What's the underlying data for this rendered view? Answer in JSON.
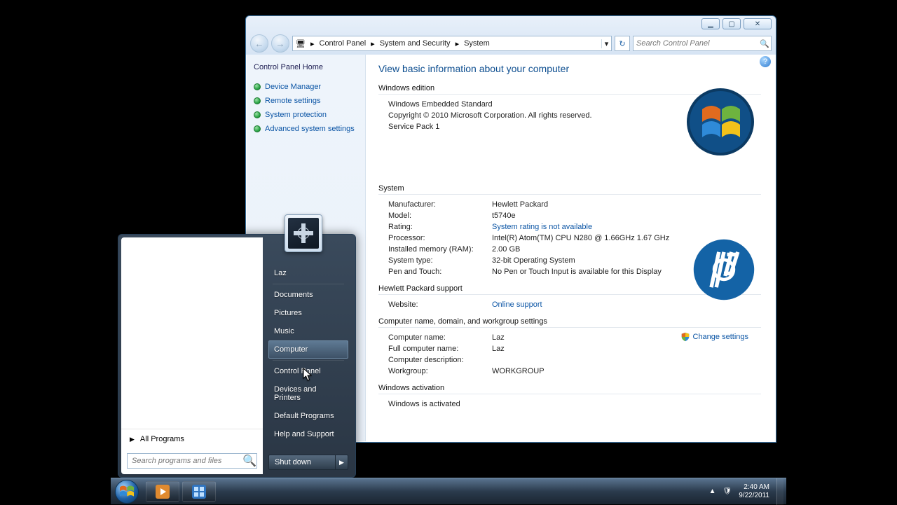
{
  "window": {
    "breadcrumbs": [
      "Control Panel",
      "System and Security",
      "System"
    ],
    "search_placeholder": "Search Control Panel",
    "sidebar": {
      "home": "Control Panel Home",
      "links": [
        "Device Manager",
        "Remote settings",
        "System protection",
        "Advanced system settings"
      ]
    },
    "heading": "View basic information about your computer",
    "edition": {
      "title": "Windows edition",
      "name": "Windows Embedded Standard",
      "copyright": "Copyright © 2010 Microsoft Corporation.  All rights reserved.",
      "sp": "Service Pack 1"
    },
    "system": {
      "title": "System",
      "rows": {
        "manufacturer_k": "Manufacturer:",
        "manufacturer_v": "Hewlett Packard",
        "model_k": "Model:",
        "model_v": "t5740e",
        "rating_k": "Rating:",
        "rating_v": "System rating is not available",
        "processor_k": "Processor:",
        "processor_v": "Intel(R) Atom(TM) CPU N280   @ 1.66GHz  1.67 GHz",
        "ram_k": "Installed memory (RAM):",
        "ram_v": "2.00 GB",
        "type_k": "System type:",
        "type_v": "32-bit Operating System",
        "pen_k": "Pen and Touch:",
        "pen_v": "No Pen or Touch Input is available for this Display"
      }
    },
    "support": {
      "title": "Hewlett Packard support",
      "website_k": "Website:",
      "website_v": "Online support"
    },
    "naming": {
      "title": "Computer name, domain, and workgroup settings",
      "rows": {
        "name_k": "Computer name:",
        "name_v": "Laz",
        "full_k": "Full computer name:",
        "full_v": "Laz",
        "desc_k": "Computer description:",
        "desc_v": "",
        "wg_k": "Workgroup:",
        "wg_v": "WORKGROUP"
      },
      "change": "Change settings"
    },
    "activation": {
      "title": "Windows activation",
      "status": "Windows is activated"
    }
  },
  "start": {
    "all_programs": "All Programs",
    "search_placeholder": "Search programs and files",
    "right": [
      "Laz",
      "Documents",
      "Pictures",
      "Music",
      "Computer",
      "Control Panel",
      "Devices and Printers",
      "Default Programs",
      "Help and Support"
    ],
    "hovered_index": 4,
    "shutdown": "Shut down"
  },
  "tray": {
    "time": "2:40 AM",
    "date": "9/22/2011"
  }
}
